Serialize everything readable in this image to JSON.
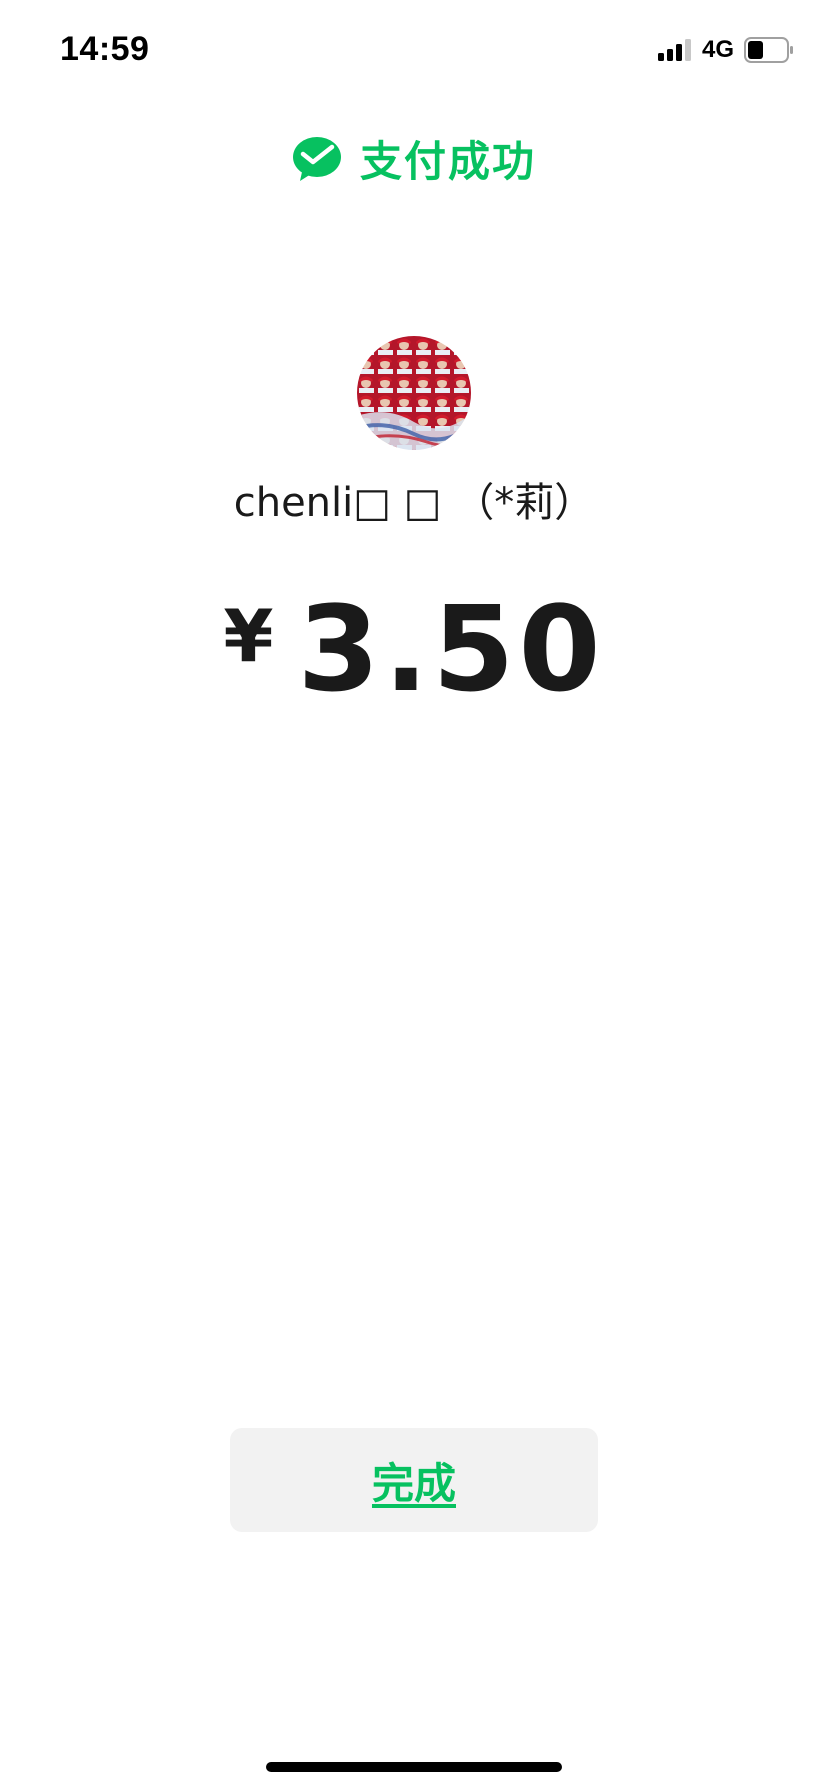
{
  "status_bar": {
    "time": "14:59",
    "network": "4G",
    "signal_icon": "signal-bars-icon",
    "battery_icon": "battery-icon"
  },
  "header": {
    "icon": "wechat-pay-check-icon",
    "title": "支付成功"
  },
  "payee": {
    "name": "chenli□ □ （*莉）"
  },
  "payment": {
    "currency_symbol": "¥",
    "amount": "3.50"
  },
  "actions": {
    "done_label": "完成"
  },
  "colors": {
    "accent": "#07C160",
    "text": "#1a1a1a",
    "button_bg": "#f2f2f2"
  }
}
